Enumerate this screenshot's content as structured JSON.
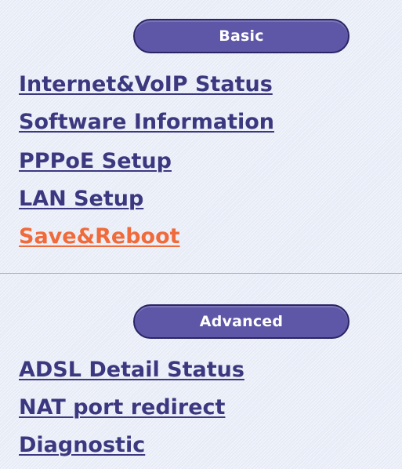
{
  "basic": {
    "title": "Basic",
    "items": [
      {
        "label": "Internet&VoIP Status"
      },
      {
        "label": "Software Information"
      },
      {
        "label": "PPPoE Setup"
      },
      {
        "label": "LAN Setup"
      },
      {
        "label": "Save&Reboot",
        "active": true
      }
    ]
  },
  "advanced": {
    "title": "Advanced",
    "items": [
      {
        "label": "ADSL Detail Status"
      },
      {
        "label": "NAT port redirect"
      },
      {
        "label": "Diagnostic"
      }
    ]
  },
  "colors": {
    "link": "#3c3880",
    "active_link": "#f06a3a",
    "pill": "#5e56a6",
    "background": "#e6ebf6"
  }
}
